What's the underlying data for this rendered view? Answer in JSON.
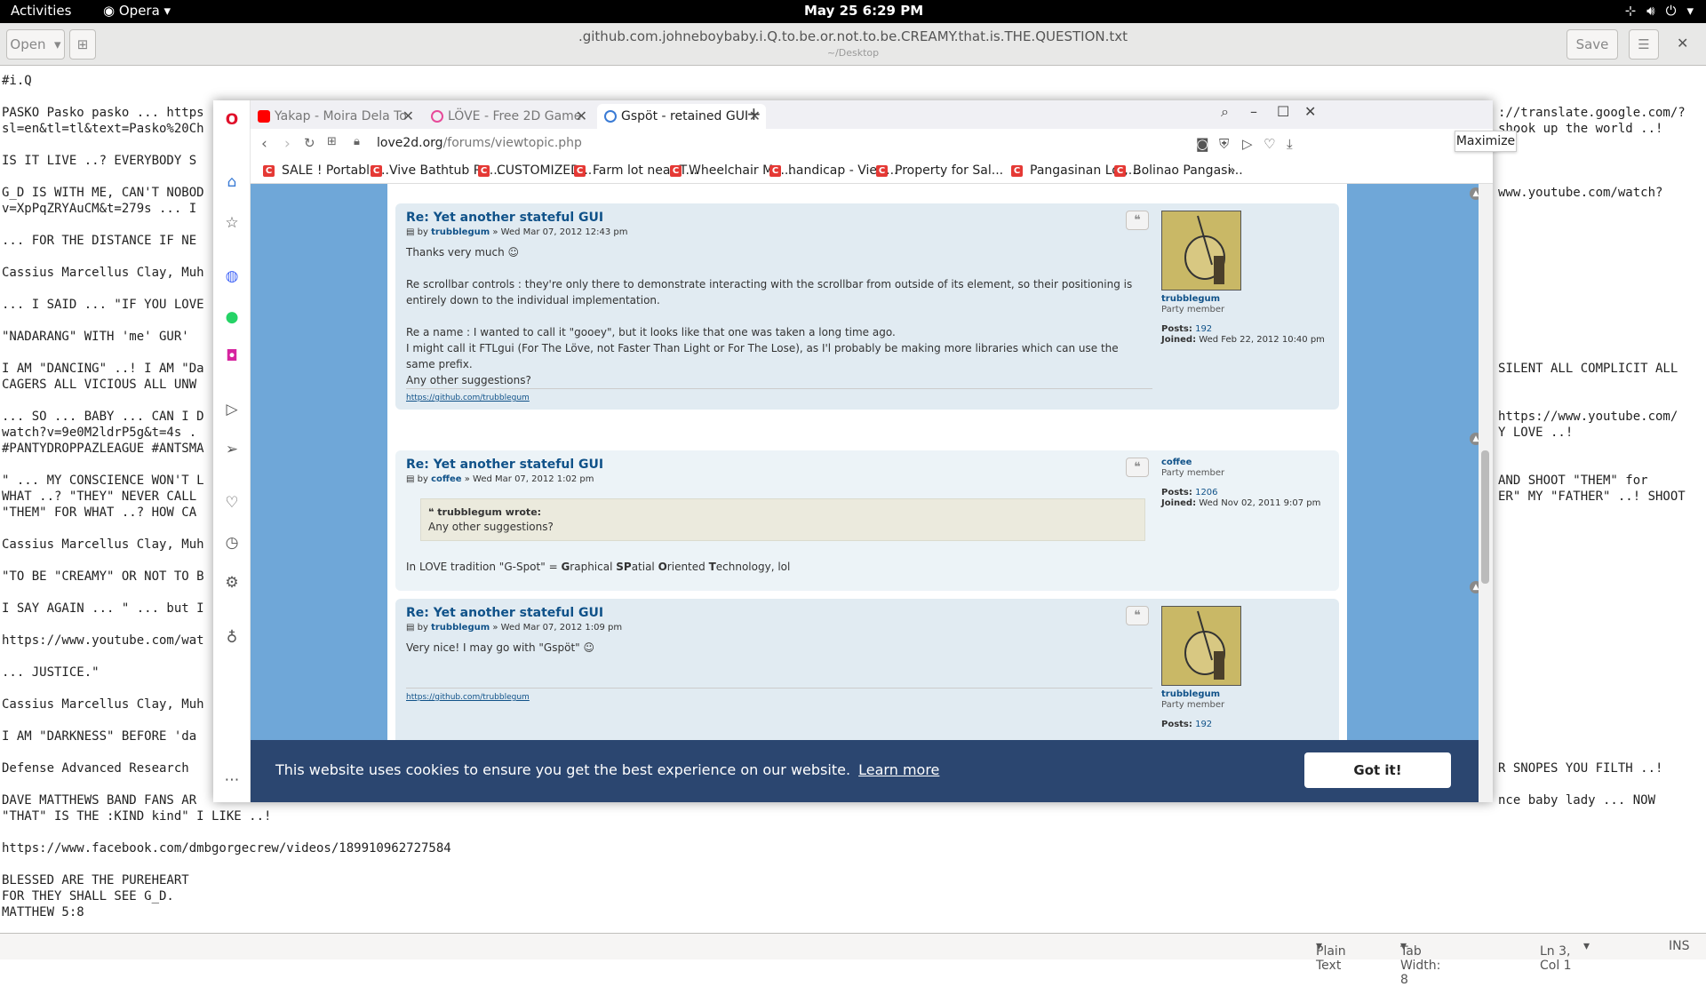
{
  "topbar": {
    "activities": "Activities",
    "app": "Opera",
    "clock": "May 25  6:29 PM"
  },
  "gedit": {
    "open": "Open",
    "title": ".github.com.johneboybaby.i.Q.to.be.or.not.to.be.CREAMY.that.is.THE.QUESTION.txt",
    "subtitle": "~/Desktop",
    "save": "Save"
  },
  "editor_left": [
    "#i.Q",
    "",
    "PASKO Pasko pasko ... https",
    "sl=en&tl=tl&text=Pasko%20Ch",
    "",
    "IS IT LIVE ..? EVERYBODY S",
    "",
    "G_D IS WITH ME, CAN'T NOBOD",
    "v=XpPqZRYAuCM&t=279s ... I",
    "",
    "... FOR THE DISTANCE IF NE",
    "",
    "Cassius Marcellus Clay, Muh",
    "",
    "... I SAID ... \"IF YOU LOVE",
    "",
    "\"NADARANG\" WITH 'me' GUR'",
    "",
    "I AM \"DANCING\" ..! I AM \"Da",
    "CAGERS ALL VICIOUS ALL UNW",
    "",
    "... SO ... BABY ... CAN I D",
    "watch?v=9e0M2ldrP5g&t=4s .",
    "#PANTYDROPPAZLEAGUE #ANTSMA",
    "",
    "\" ... MY CONSCIENCE WON'T L",
    "WHAT ..? \"THEY\" NEVER CALL",
    "\"THEM\" FOR WHAT ..? HOW CA",
    "",
    "Cassius Marcellus Clay, Muh",
    "",
    "\"TO BE \"CREAMY\" OR NOT TO B",
    "",
    "I SAY AGAIN ... \" ... but I",
    "",
    "https://www.youtube.com/wat",
    "",
    "... JUSTICE.\"",
    "",
    "Cassius Marcellus Clay, Muh",
    "",
    "I AM \"DARKNESS\" BEFORE 'da",
    "",
    "Defense Advanced Research",
    "",
    "DAVE MATTHEWS BAND FANS AR",
    "\"THAT\" IS THE :KIND kind\" I LIKE ..!",
    "",
    "https://www.facebook.com/dmbgorgecrew/videos/189910962727584",
    "",
    "BLESSED ARE THE PUREHEART",
    "FOR THEY SHALL SEE G_D.",
    "MATTHEW 5:8"
  ],
  "editor_right": [
    {
      "row": 2,
      "text": "://translate.google.com/?"
    },
    {
      "row": 3,
      "text": "shook up the world ..!"
    },
    {
      "row": 7,
      "text": "www.youtube.com/watch?"
    },
    {
      "row": 18,
      "text": "SILENT ALL COMPLICIT ALL"
    },
    {
      "row": 21,
      "text": "https://www.youtube.com/"
    },
    {
      "row": 22,
      "text": "Y LOVE ..!"
    },
    {
      "row": 25,
      "text": "AND SHOOT \"THEM\" for"
    },
    {
      "row": 26,
      "text": "ER\" MY \"FATHER\" ..! SHOOT"
    },
    {
      "row": 43,
      "text": "R SNOPES YOU FILTH ..!"
    },
    {
      "row": 45,
      "text": "nce baby lady ... NOW"
    }
  ],
  "status": {
    "lang": "Plain Text",
    "tab": "Tab Width: 8",
    "pos": "Ln 3, Col 1",
    "mode": "INS"
  },
  "browser": {
    "tabs": [
      "Yakap - Moira Dela To",
      "LÖVE - Free 2D Game",
      "Gspöt - retained GUI l"
    ],
    "url_host": "love2d.org",
    "url_path": "/forums/viewtopic.php",
    "bookmarks": [
      "SALE ! Portable...",
      "Vive Bathtub Ra...",
      "CUSTOMIZED...",
      "Farm lot near T...",
      "Wheelchair Mo...",
      "handicap - View...",
      "Property for Sal...",
      "Pangasinan Lot,...",
      "Bolinao Pangasi..."
    ],
    "tooltip": "Maximize"
  },
  "posts": [
    {
      "title": "Re: Yet another stateful GUI",
      "author": "trubblegum",
      "date": "» Wed Mar 07, 2012 12:43 pm",
      "by": "by",
      "body": [
        "Thanks very much ☺",
        "",
        "Re scrollbar controls : they're only there to demonstrate interacting with the scrollbar from outside of its element, so their positioning is entirely down to the individual implementation.",
        "",
        "Re a name : I wanted to call it \"gooey\", but it looks like that one was taken a long time ago.",
        "I might call it FTLgui (For The Löve, not Faster Than Light or For The Lose), as I'l probably be making more libraries which can use the same prefix.",
        "Any other suggestions?"
      ],
      "sig": "https://github.com/trubblegum",
      "profile": {
        "name": "trubblegum",
        "rank": "Party member",
        "posts_label": "Posts:",
        "posts": "192",
        "joined_label": "Joined:",
        "joined": "Wed Feb 22, 2012 10:40 pm"
      }
    },
    {
      "title": "Re: Yet another stateful GUI",
      "author": "coffee",
      "date": "» Wed Mar 07, 2012 1:02 pm",
      "by": "by",
      "quote_author": "trubblegum wrote:",
      "quote_text": "Any other suggestions?",
      "body_pre": "In LOVE tradition \"G-Spot\" = ",
      "body_g": "G",
      "body_1": "raphical ",
      "body_sp": "SP",
      "body_2": "atial ",
      "body_o": "O",
      "body_3": "riented ",
      "body_t": "T",
      "body_4": "echnology, lol",
      "profile": {
        "name": "coffee",
        "rank": "Party member",
        "posts_label": "Posts:",
        "posts": "1206",
        "joined_label": "Joined:",
        "joined": "Wed Nov 02, 2011 9:07 pm"
      }
    },
    {
      "title": "Re: Yet another stateful GUI",
      "author": "trubblegum",
      "date": "» Wed Mar 07, 2012 1:09 pm",
      "by": "by",
      "body": "Very nice! I may go with \"Gspöt\" ☺",
      "sig": "https://github.com/trubblegum",
      "profile": {
        "name": "trubblegum",
        "rank": "Party member",
        "posts_label": "Posts:",
        "posts": "192"
      }
    }
  ],
  "cookie": {
    "message": "This website uses cookies to ensure you get the best experience on our website.",
    "learn": "Learn more",
    "button": "Got it!"
  }
}
